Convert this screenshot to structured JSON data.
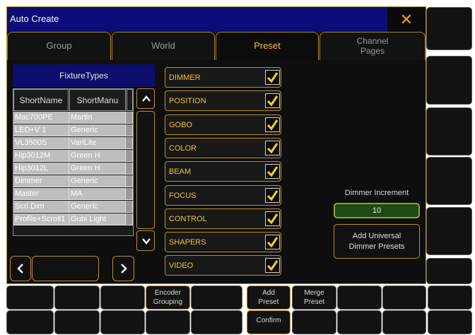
{
  "window": {
    "title": "Auto Create",
    "close_glyph": "✕"
  },
  "tabs": [
    {
      "label": "Group",
      "active": false
    },
    {
      "label": "World",
      "active": false
    },
    {
      "label": "Preset",
      "active": true
    },
    {
      "label_line1": "Channel",
      "label_line2": "Pages",
      "active": false
    }
  ],
  "fixture_types": {
    "header": "FixtureTypes",
    "columns": [
      "ShortName",
      "ShortManu"
    ],
    "rows": [
      [
        "Mac700PE",
        "Martin"
      ],
      [
        "LED+V 1",
        "Generic"
      ],
      [
        "VL3500S",
        "VariLite"
      ],
      [
        "Hip3012M",
        "Green H"
      ],
      [
        "Hip3012L",
        "Green H"
      ],
      [
        "Dimmer",
        "Generic"
      ],
      [
        "Master",
        "MA"
      ],
      [
        "Scrl Dim",
        "Generic"
      ],
      [
        "Profile+Scroll1",
        "Gubi Light"
      ]
    ],
    "scroll_up_icon": "up-chevron-icon",
    "scroll_down_icon": "down-chevron-icon",
    "page_left_icon": "left-chevron-icon",
    "page_right_icon": "right-chevron-icon",
    "page_value": ""
  },
  "preset_types": [
    {
      "label": "DIMMER",
      "checked": true
    },
    {
      "label": "POSITION",
      "checked": true
    },
    {
      "label": "GOBO",
      "checked": true
    },
    {
      "label": "COLOR",
      "checked": true
    },
    {
      "label": "BEAM",
      "checked": true
    },
    {
      "label": "FOCUS",
      "checked": true
    },
    {
      "label": "CONTROL",
      "checked": true
    },
    {
      "label": "SHAPERS",
      "checked": true
    },
    {
      "label": "VIDEO",
      "checked": true
    }
  ],
  "dimmer": {
    "increment_label": "Dimmer Increment",
    "increment_value": "10",
    "add_universal_line1": "Add Universal",
    "add_universal_line2": "Dimmer Presets"
  },
  "bottom_bar": {
    "encoder_grouping_line1": "Encoder",
    "encoder_grouping_line2": "Grouping",
    "add_preset_line1": "Add",
    "add_preset_line2": "Preset",
    "merge_preset_line1": "Merge",
    "merge_preset_line2": "Preset",
    "confirm": "Confirm"
  },
  "colors": {
    "accent_gold": "#b8902a",
    "label_yellow": "#f5c331",
    "title_blue": "#0c0c78",
    "check_yellow": "#f2d21c",
    "increment_green": "#1e4a16"
  }
}
